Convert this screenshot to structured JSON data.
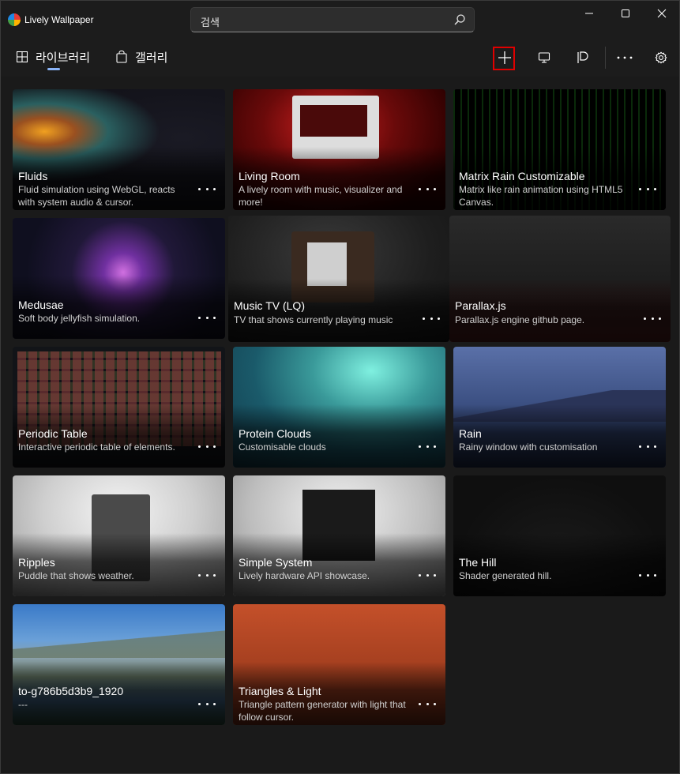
{
  "app": {
    "title": "Lively Wallpaper"
  },
  "search": {
    "placeholder": "검색"
  },
  "nav": {
    "tabs": [
      {
        "label": "라이브러리",
        "icon": "grid-icon"
      },
      {
        "label": "갤러리",
        "icon": "shopping-bag-icon"
      }
    ]
  },
  "library": {
    "items": [
      {
        "title": "Fluids",
        "description": "Fluid simulation using WebGL, reacts with system audio & cursor."
      },
      {
        "title": "Living Room",
        "description": "A lively room with music, visualizer and more!"
      },
      {
        "title": "Matrix Rain Customizable",
        "description": "Matrix like rain animation using HTML5 Canvas."
      },
      {
        "title": "Medusae",
        "description": "Soft body jellyfish simulation."
      },
      {
        "title": "Music TV (LQ)",
        "description": "TV that shows currently playing music"
      },
      {
        "title": "Parallax.js",
        "description": "Parallax.js engine github page."
      },
      {
        "title": "Periodic Table",
        "description": "Interactive periodic table of elements."
      },
      {
        "title": "Protein Clouds",
        "description": "Customisable clouds"
      },
      {
        "title": "Rain",
        "description": "Rainy window with customisation"
      },
      {
        "title": "Ripples",
        "description": "Puddle that shows weather."
      },
      {
        "title": "Simple System",
        "description": "Lively hardware API showcase."
      },
      {
        "title": "The Hill",
        "description": "Shader generated hill."
      },
      {
        "title": "to-g786b5d3b9_1920",
        "description": "---"
      },
      {
        "title": "Triangles & Light",
        "description": "Triangle pattern generator with light that follow cursor."
      }
    ]
  },
  "colors": {
    "accent": "#8ab4f8",
    "highlight_box": "#e00000"
  }
}
